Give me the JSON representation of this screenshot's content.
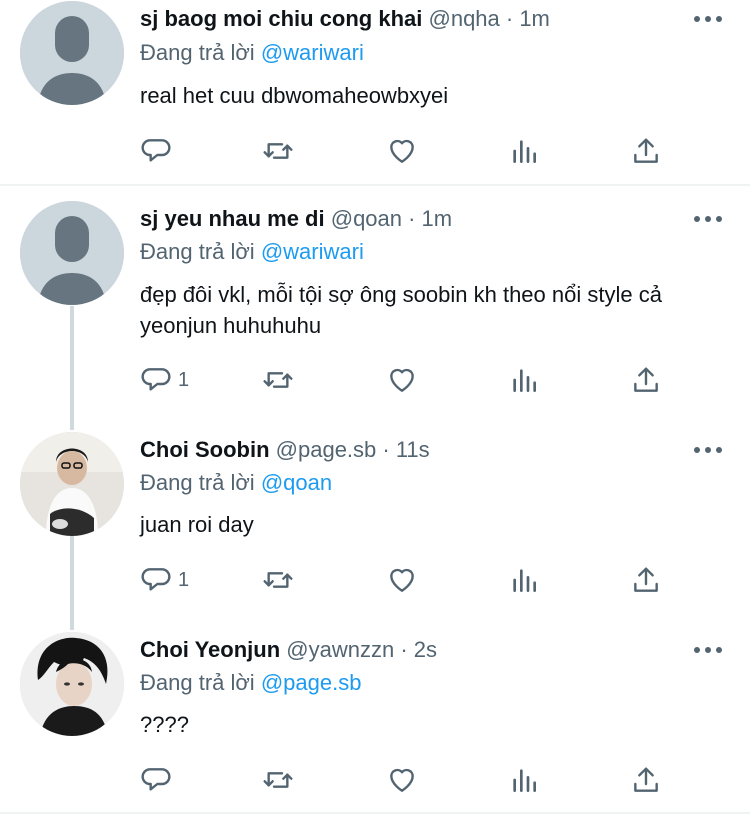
{
  "tweets": [
    {
      "name": "sj baog moi chiu cong khai",
      "meta": "@nqha · 1m",
      "reply_prefix": "Đang trả lời",
      "reply_to": "@wariwari",
      "text": "real het cuu dbwomaheowbxyei",
      "reply_count": ""
    },
    {
      "name": "sj yeu nhau me di",
      "meta": "@qoan · 1m",
      "reply_prefix": "Đang trả lời",
      "reply_to": "@wariwari",
      "text": "đẹp đôi vkl, mỗi tội sợ ông soobin kh theo nổi style cả yeonjun huhuhuhu",
      "reply_count": "1"
    },
    {
      "name": "Choi Soobin",
      "meta": "@page.sb · 11s",
      "reply_prefix": "Đang trả lời",
      "reply_to": "@qoan",
      "text": "juan roi day",
      "reply_count": "1"
    },
    {
      "name": "Choi Yeonjun",
      "meta": "@yawnzzn · 2s",
      "reply_prefix": "Đang trả lời",
      "reply_to": "@page.sb",
      "text": "????",
      "reply_count": ""
    }
  ],
  "icons": [
    "reply-icon",
    "retweet-icon",
    "like-icon",
    "views-icon",
    "share-icon",
    "more-icon"
  ],
  "colors": {
    "link": "#1d9bf0",
    "secondary": "#536471",
    "icon": "#536471"
  }
}
